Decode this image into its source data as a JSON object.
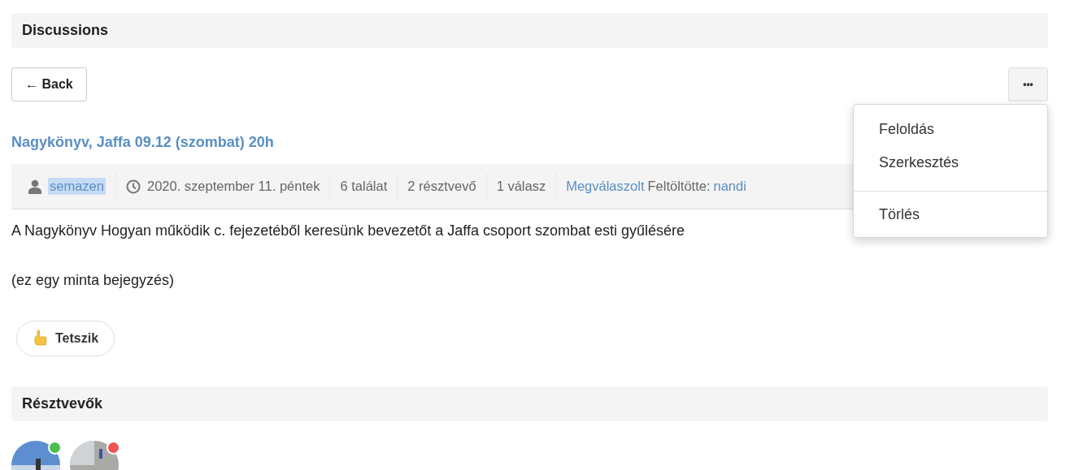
{
  "header": {
    "title": "Discussions"
  },
  "back_button": {
    "label": "← Back"
  },
  "more_button": {
    "label": "•••"
  },
  "menu": {
    "items": [
      {
        "label": "Feloldás",
        "kind": "item"
      },
      {
        "label": "Szerkesztés",
        "kind": "item"
      },
      {
        "kind": "divider"
      },
      {
        "label": "Törlés",
        "kind": "item"
      }
    ]
  },
  "post": {
    "title": "Nagykönyv, Jaffa 09.12 (szombat) 20h",
    "meta": [
      {
        "kind": "user",
        "text": "semazen",
        "highlighted": true
      },
      {
        "kind": "date",
        "text": "2020. szeptember 11. péntek"
      },
      {
        "kind": "plain",
        "text": "6 találat"
      },
      {
        "kind": "plain",
        "text": "2 résztvevő"
      },
      {
        "kind": "plain",
        "text": "1 válasz"
      },
      {
        "kind": "status",
        "status": "Megválaszolt",
        "label": "Feltöltötte:",
        "uploader": "nandi"
      }
    ],
    "body": [
      "A Nagykönyv Hogyan működik c. fejezetéből keresünk bevezetőt a Jaffa csoport szombat esti gyűlésére",
      "(ez egy minta bejegyzés)"
    ],
    "like_button": {
      "label": "Tetszik"
    }
  },
  "participants": {
    "title": "Résztvevők"
  }
}
